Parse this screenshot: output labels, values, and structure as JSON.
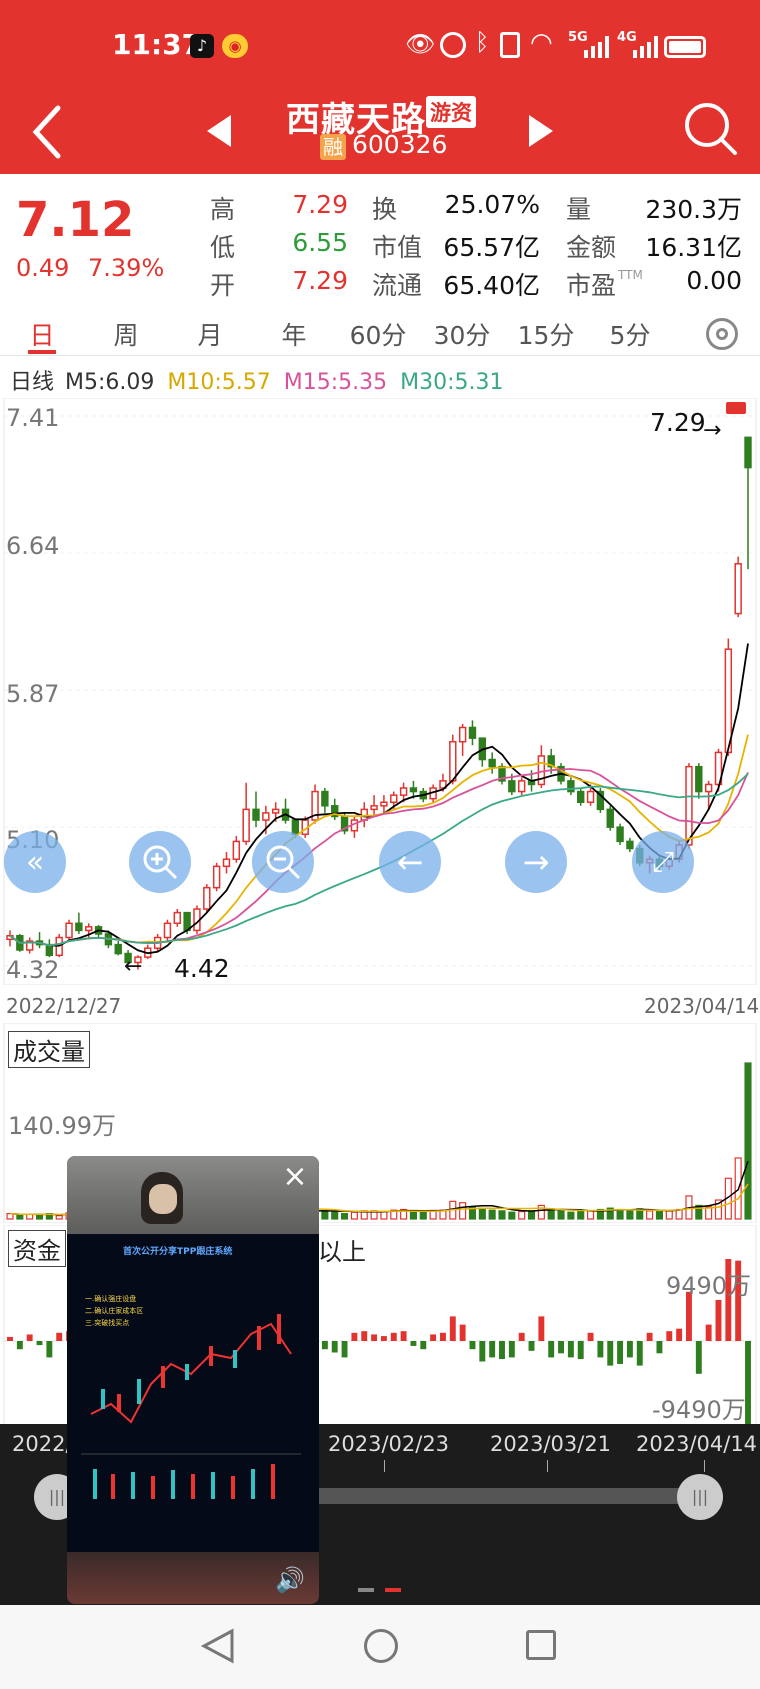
{
  "status": {
    "time": "11:37",
    "net1": "5G",
    "net2": "4G"
  },
  "header": {
    "stock_name": "西藏天路",
    "tag": "游资",
    "margin_badge": "融",
    "code": "600326"
  },
  "quote": {
    "price": "7.12",
    "change": "0.49",
    "change_pct": "7.39%",
    "rows": [
      [
        {
          "label": "高",
          "value": "7.29",
          "color": "#e3332e"
        },
        {
          "label": "换",
          "value": "25.07%"
        },
        {
          "label": "量",
          "value": "230.3万"
        }
      ],
      [
        {
          "label": "低",
          "value": "6.55",
          "color": "#2e9c3a"
        },
        {
          "label": "市值",
          "value": "65.57亿"
        },
        {
          "label": "金额",
          "value": "16.31亿"
        }
      ],
      [
        {
          "label": "开",
          "value": "7.29",
          "color": "#e3332e"
        },
        {
          "label": "流通",
          "value": "65.40亿"
        },
        {
          "label": "市盈",
          "sup": "TTM",
          "value": "0.00"
        }
      ]
    ]
  },
  "tabs": [
    "日",
    "周",
    "月",
    "年",
    "60分",
    "30分",
    "15分",
    "5分"
  ],
  "ma": {
    "label": "日线",
    "m5": "M5:6.09",
    "m10": "M10:5.57",
    "m15": "M15:5.35",
    "m30": "M30:5.31"
  },
  "colors": {
    "up": "#e3332e",
    "down": "#2e7d1f",
    "m5": "#000000",
    "m10": "#e8b400",
    "m15": "#d9529a",
    "m30": "#3aa886",
    "header": "#e3332e"
  },
  "chart_data": {
    "type": "candlestick",
    "y_ticks": [
      "7.41",
      "6.64",
      "5.87",
      "5.10",
      "4.32"
    ],
    "ylim": [
      4.32,
      7.41
    ],
    "x_start": "2022/12/27",
    "x_end": "2023/04/14",
    "high_marker": "7.29",
    "low_marker": "4.42",
    "candles": [
      [
        4.47,
        4.52,
        4.43,
        4.49
      ],
      [
        4.49,
        4.5,
        4.4,
        4.41
      ],
      [
        4.41,
        4.48,
        4.39,
        4.46
      ],
      [
        4.46,
        4.51,
        4.42,
        4.44
      ],
      [
        4.44,
        4.47,
        4.37,
        4.38
      ],
      [
        4.38,
        4.5,
        4.37,
        4.48
      ],
      [
        4.48,
        4.58,
        4.46,
        4.56
      ],
      [
        4.56,
        4.62,
        4.5,
        4.52
      ],
      [
        4.52,
        4.56,
        4.47,
        4.54
      ],
      [
        4.54,
        4.55,
        4.48,
        4.5
      ],
      [
        4.5,
        4.52,
        4.42,
        4.44
      ],
      [
        4.44,
        4.46,
        4.38,
        4.39
      ],
      [
        4.39,
        4.41,
        4.33,
        4.34
      ],
      [
        4.34,
        4.38,
        4.3,
        4.37
      ],
      [
        4.37,
        4.44,
        4.36,
        4.42
      ],
      [
        4.42,
        4.5,
        4.4,
        4.48
      ],
      [
        4.48,
        4.58,
        4.46,
        4.56
      ],
      [
        4.56,
        4.64,
        4.54,
        4.62
      ],
      [
        4.62,
        4.6,
        4.5,
        4.52
      ],
      [
        4.52,
        4.66,
        4.5,
        4.64
      ],
      [
        4.64,
        4.78,
        4.62,
        4.76
      ],
      [
        4.76,
        4.9,
        4.74,
        4.88
      ],
      [
        4.88,
        4.96,
        4.84,
        4.92
      ],
      [
        4.92,
        5.05,
        4.9,
        5.02
      ],
      [
        5.02,
        5.35,
        5.0,
        5.2
      ],
      [
        5.2,
        5.3,
        5.1,
        5.14
      ],
      [
        5.14,
        5.22,
        5.06,
        5.18
      ],
      [
        5.18,
        5.24,
        5.13,
        5.2
      ],
      [
        5.2,
        5.26,
        5.12,
        5.14
      ],
      [
        5.14,
        5.12,
        5.04,
        5.06
      ],
      [
        5.06,
        5.16,
        5.04,
        5.14
      ],
      [
        5.14,
        5.34,
        5.12,
        5.3
      ],
      [
        5.3,
        5.32,
        5.18,
        5.22
      ],
      [
        5.22,
        5.26,
        5.14,
        5.16
      ],
      [
        5.16,
        5.18,
        5.06,
        5.08
      ],
      [
        5.08,
        5.16,
        5.04,
        5.14
      ],
      [
        5.14,
        5.24,
        5.1,
        5.2
      ],
      [
        5.2,
        5.28,
        5.16,
        5.22
      ],
      [
        5.22,
        5.28,
        5.18,
        5.24
      ],
      [
        5.24,
        5.3,
        5.2,
        5.28
      ],
      [
        5.28,
        5.35,
        5.24,
        5.32
      ],
      [
        5.32,
        5.36,
        5.26,
        5.3
      ],
      [
        5.3,
        5.32,
        5.24,
        5.26
      ],
      [
        5.26,
        5.34,
        5.24,
        5.32
      ],
      [
        5.32,
        5.4,
        5.3,
        5.36
      ],
      [
        5.36,
        5.62,
        5.34,
        5.58
      ],
      [
        5.58,
        5.68,
        5.5,
        5.66
      ],
      [
        5.66,
        5.7,
        5.56,
        5.6
      ],
      [
        5.6,
        5.6,
        5.44,
        5.48
      ],
      [
        5.48,
        5.52,
        5.4,
        5.44
      ],
      [
        5.44,
        5.46,
        5.34,
        5.36
      ],
      [
        5.36,
        5.4,
        5.28,
        5.3
      ],
      [
        5.3,
        5.38,
        5.28,
        5.36
      ],
      [
        5.36,
        5.42,
        5.3,
        5.34
      ],
      [
        5.34,
        5.56,
        5.32,
        5.5
      ],
      [
        5.5,
        5.54,
        5.4,
        5.44
      ],
      [
        5.44,
        5.46,
        5.34,
        5.36
      ],
      [
        5.36,
        5.38,
        5.28,
        5.3
      ],
      [
        5.3,
        5.32,
        5.22,
        5.24
      ],
      [
        5.24,
        5.34,
        5.22,
        5.3
      ],
      [
        5.3,
        5.32,
        5.18,
        5.2
      ],
      [
        5.2,
        5.22,
        5.08,
        5.1
      ],
      [
        5.1,
        5.12,
        5.0,
        5.02
      ],
      [
        5.02,
        5.04,
        4.96,
        4.98
      ],
      [
        4.98,
        5.0,
        4.88,
        4.9
      ],
      [
        4.9,
        4.94,
        4.84,
        4.92
      ],
      [
        4.92,
        4.94,
        4.86,
        4.88
      ],
      [
        4.88,
        4.94,
        4.86,
        4.92
      ],
      [
        4.92,
        5.02,
        4.9,
        5.0
      ],
      [
        5.0,
        5.46,
        4.98,
        5.44
      ],
      [
        5.44,
        5.46,
        5.26,
        5.3
      ],
      [
        5.3,
        5.36,
        5.2,
        5.34
      ],
      [
        5.34,
        5.54,
        5.3,
        5.52
      ],
      [
        5.52,
        6.16,
        5.5,
        6.1
      ],
      [
        6.3,
        6.62,
        6.28,
        6.58
      ],
      [
        7.29,
        7.29,
        6.55,
        7.12
      ]
    ],
    "volume_label": "成交量",
    "volume_tick": "140.99万",
    "volume": [
      8,
      6,
      7,
      6,
      8,
      5,
      9,
      7,
      6,
      5,
      6,
      7,
      8,
      6,
      7,
      9,
      10,
      11,
      8,
      12,
      14,
      15,
      16,
      14,
      25,
      18,
      14,
      12,
      11,
      9,
      12,
      16,
      12,
      10,
      8,
      10,
      12,
      12,
      11,
      13,
      14,
      12,
      11,
      12,
      13,
      26,
      24,
      18,
      16,
      13,
      12,
      10,
      11,
      12,
      20,
      15,
      12,
      10,
      11,
      12,
      14,
      16,
      14,
      12,
      15,
      12,
      11,
      12,
      14,
      34,
      20,
      18,
      28,
      60,
      90,
      230
    ],
    "fund_label": "资金",
    "fund_suffix": "以上",
    "fund_ticks": [
      "9490万",
      "-9490万"
    ],
    "fund": [
      0.05,
      -0.1,
      0.08,
      -0.05,
      -0.2,
      0.1,
      0.12,
      -0.08,
      0.04,
      -0.06,
      -0.1,
      -0.15,
      -0.2,
      0.06,
      0.1,
      0.12,
      0.15,
      0.18,
      -0.1,
      0.2,
      0.25,
      0.2,
      0.18,
      0.15,
      0.3,
      -0.2,
      0.1,
      0.08,
      -0.12,
      -0.18,
      0.1,
      0.2,
      -0.1,
      -0.14,
      -0.2,
      0.1,
      0.12,
      0.08,
      0.06,
      0.1,
      0.12,
      -0.06,
      -0.1,
      0.08,
      0.1,
      0.3,
      0.2,
      -0.1,
      -0.25,
      -0.2,
      -0.22,
      -0.2,
      0.1,
      -0.12,
      0.3,
      -0.2,
      -0.15,
      -0.2,
      -0.22,
      0.1,
      -0.2,
      -0.3,
      -0.28,
      -0.2,
      -0.3,
      0.1,
      -0.15,
      0.12,
      0.15,
      0.6,
      -0.4,
      0.2,
      0.5,
      1.0,
      0.98,
      -1.2
    ],
    "timeline_labels": [
      "2022/",
      "2023/02/23",
      "2023/03/21",
      "2023/04/14"
    ]
  },
  "video": {
    "title": "首次公开分享TPP跟庄系统",
    "lines": [
      "一.确认强庄设盘",
      "二.确认庄家成本区",
      "三.突破找买点"
    ],
    "close": "×"
  }
}
